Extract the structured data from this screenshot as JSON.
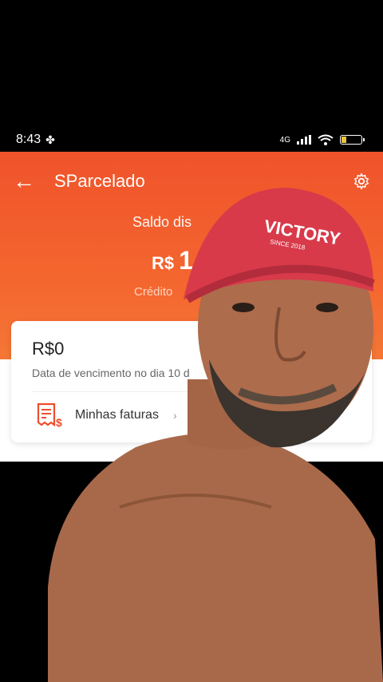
{
  "status_bar": {
    "time": "8:43",
    "network": "4G"
  },
  "toolbar": {
    "title": "SParcelado"
  },
  "balance": {
    "label": "Saldo dis",
    "currency": "R$",
    "value": "1",
    "credit_label": "Crédito"
  },
  "card": {
    "amount": "R$0",
    "due_text": "Data de vencimento no dia 10 d",
    "invoices_label": "Minhas faturas",
    "chevron": "›"
  },
  "overlay": {
    "cap_text": "VICTORY",
    "cap_subtext": "SINCE 2018"
  },
  "colors": {
    "brand_orange": "#f0532b",
    "cap_red": "#d83a4a"
  },
  "icons": {
    "back": "back-arrow-icon",
    "settings": "gear-icon",
    "invoice": "invoice-icon"
  }
}
